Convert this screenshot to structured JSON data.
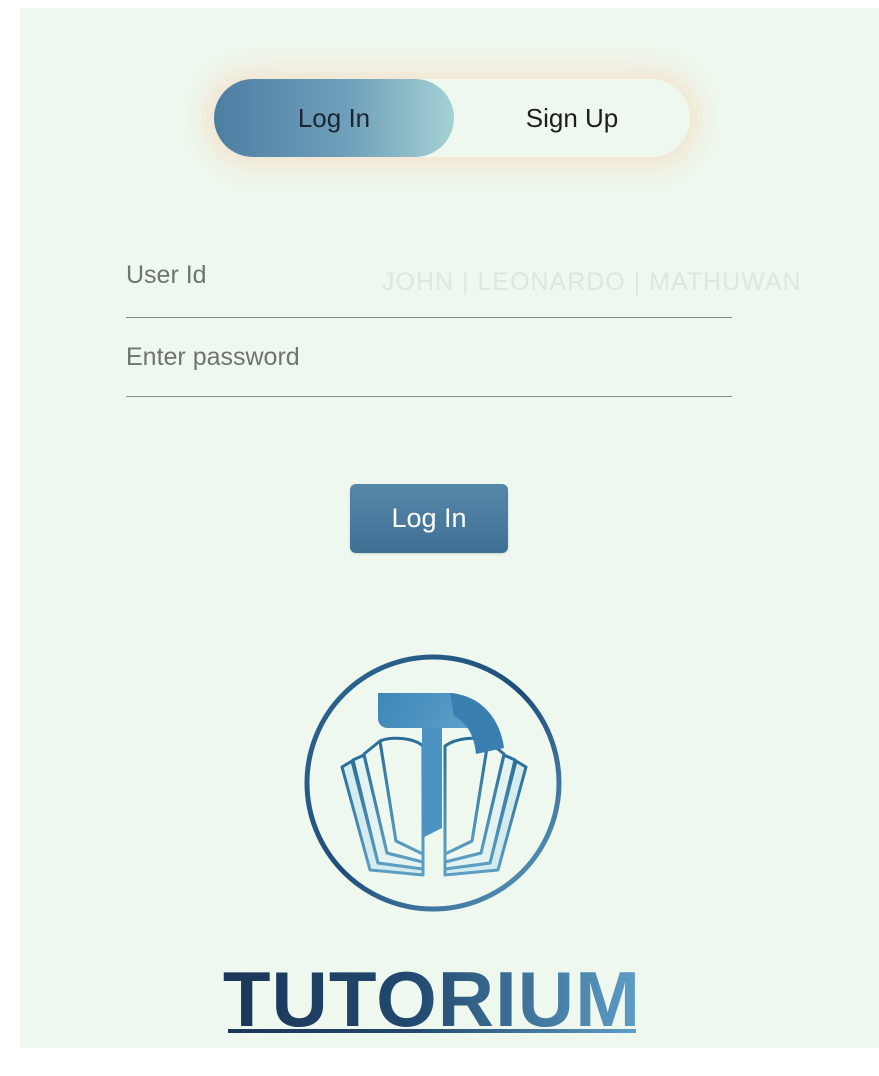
{
  "toggle": {
    "login_label": "Log In",
    "signup_label": "Sign Up"
  },
  "form": {
    "user_placeholder": "User Id",
    "password_placeholder": "Enter password",
    "background_text": "JOHN | LEONARDO | MATHUWAN",
    "submit_label": "Log In"
  },
  "brand": {
    "name": "TUTORIUM",
    "logo_icon": "book-logo-icon"
  },
  "colors": {
    "panel_bg": "#eef8ee",
    "accent": "#4d7ea3",
    "accent_light": "#a4d1d3",
    "brand_dark": "#1f3f66"
  }
}
